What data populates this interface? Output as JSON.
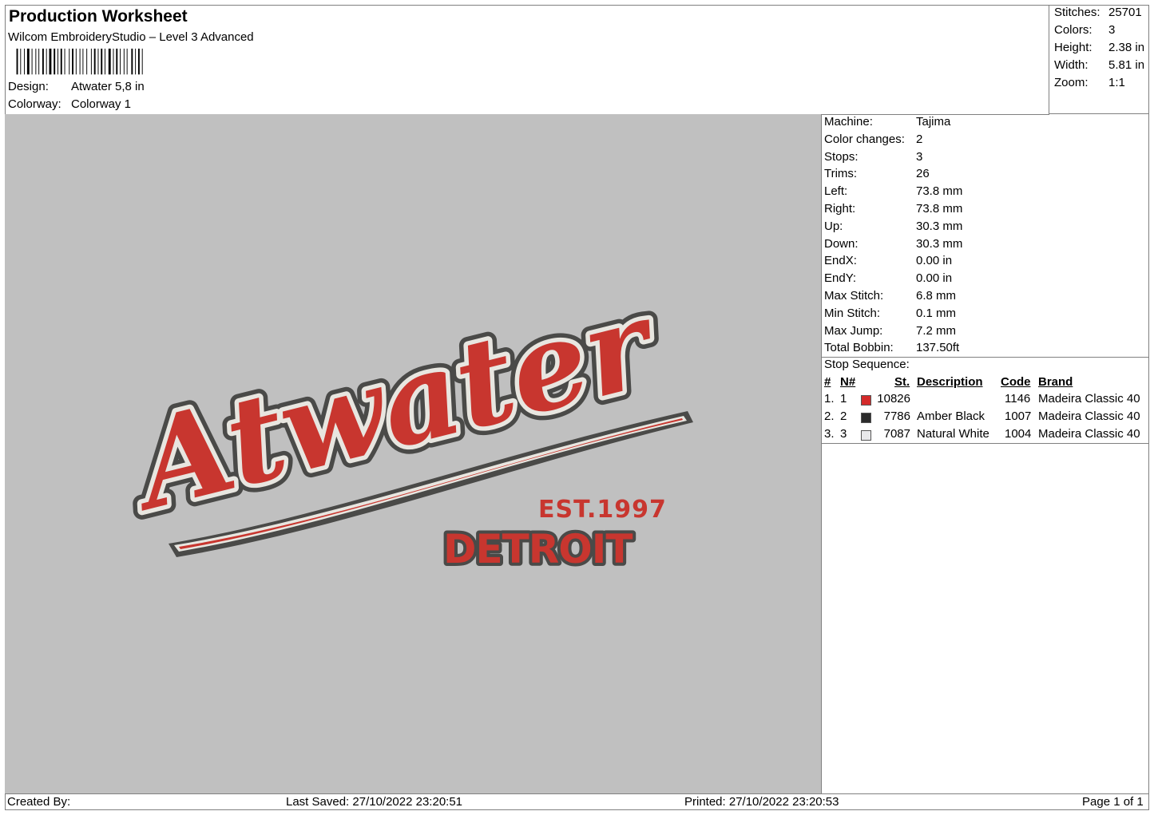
{
  "header": {
    "title": "Production Worksheet",
    "subtitle": "Wilcom EmbroideryStudio – Level 3 Advanced",
    "design_label": "Design:",
    "design_value": "Atwater 5,8 in",
    "colorway_label": "Colorway:",
    "colorway_value": "Colorway 1"
  },
  "summary": {
    "rows": [
      {
        "label": "Stitches:",
        "value": "25701"
      },
      {
        "label": "Colors:",
        "value": "3"
      },
      {
        "label": "Height:",
        "value": "2.38 in"
      },
      {
        "label": "Width:",
        "value": "5.81 in"
      },
      {
        "label": "Zoom:",
        "value": "1:1"
      }
    ]
  },
  "machine": {
    "rows": [
      {
        "label": "Machine:",
        "value": "Tajima"
      },
      {
        "label": "Color changes:",
        "value": "2"
      },
      {
        "label": "Stops:",
        "value": "3"
      },
      {
        "label": "Trims:",
        "value": "26"
      },
      {
        "label": "Left:",
        "value": "73.8 mm"
      },
      {
        "label": "Right:",
        "value": "73.8 mm"
      },
      {
        "label": "Up:",
        "value": "30.3 mm"
      },
      {
        "label": "Down:",
        "value": "30.3 mm"
      },
      {
        "label": "EndX:",
        "value": "0.00 in"
      },
      {
        "label": "EndY:",
        "value": "0.00 in"
      },
      {
        "label": "Max Stitch:",
        "value": "6.8 mm"
      },
      {
        "label": "Min Stitch:",
        "value": "0.1 mm"
      },
      {
        "label": "Max Jump:",
        "value": "7.2 mm"
      },
      {
        "label": "Total Bobbin:",
        "value": "137.50ft"
      }
    ]
  },
  "stops": {
    "title": "Stop Sequence:",
    "columns": {
      "num": "#",
      "n": "N#",
      "st": "St.",
      "desc": "Description",
      "code": "Code",
      "brand": "Brand"
    },
    "rows": [
      {
        "num": "1.",
        "n": "1",
        "color": "#d42a2a",
        "st": "10826",
        "desc": "",
        "code": "1146",
        "brand": "Madeira Classic 40"
      },
      {
        "num": "2.",
        "n": "2",
        "color": "#2b2b2b",
        "st": "7786",
        "desc": "Amber Black",
        "code": "1007",
        "brand": "Madeira Classic 40"
      },
      {
        "num": "3.",
        "n": "3",
        "color": "#e8e8ea",
        "st": "7087",
        "desc": "Natural White",
        "code": "1004",
        "brand": "Madeira Classic 40"
      }
    ]
  },
  "design": {
    "script_text": "Atwater",
    "est_text": "EST.1997",
    "city_text": "DETROIT",
    "colors": {
      "red": "#c8362f",
      "dark": "#4a4a48",
      "white": "#e8e6e0",
      "bg": "#c0c0c0"
    }
  },
  "footer": {
    "created_by": "Created By:",
    "last_saved": "Last Saved: 27/10/2022 23:20:51",
    "printed": "Printed: 27/10/2022 23:20:53",
    "page": "Page 1 of 1"
  }
}
